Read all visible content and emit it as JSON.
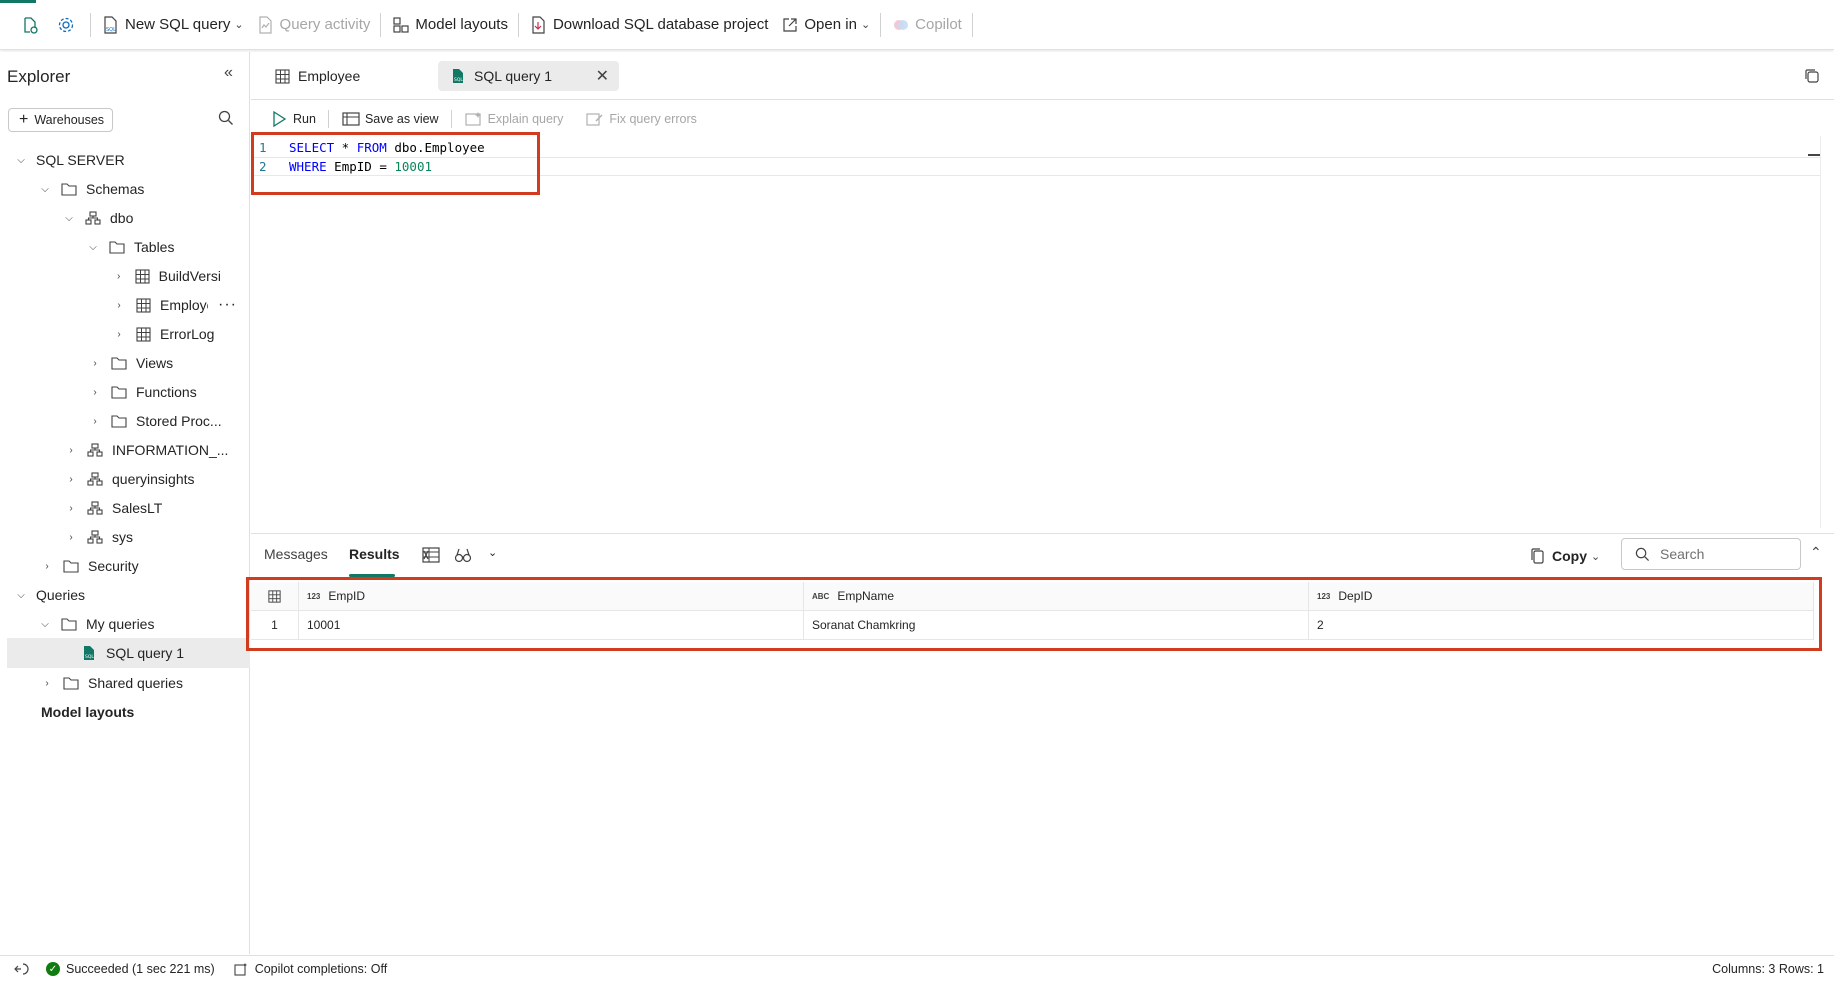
{
  "toolbar": {
    "new_sql_query": "New SQL query",
    "query_activity": "Query activity",
    "model_layouts": "Model layouts",
    "download_project": "Download SQL database project",
    "open_in": "Open in",
    "copilot": "Copilot"
  },
  "explorer": {
    "title": "Explorer",
    "add_button": "Warehouses",
    "tree": {
      "root": "SQL SERVER",
      "schemas": "Schemas",
      "dbo": "dbo",
      "tables": "Tables",
      "table_buildversion": "BuildVersic",
      "table_employee": "Employe",
      "table_errorlog": "ErrorLog",
      "views": "Views",
      "functions": "Functions",
      "stored_procs": "Stored Proc...",
      "information_schema": "INFORMATION_...",
      "queryinsights": "queryinsights",
      "saleslt": "SalesLT",
      "sys": "sys",
      "security": "Security",
      "queries": "Queries",
      "my_queries": "My queries",
      "sql_query_1": "SQL query 1",
      "shared_queries": "Shared queries",
      "model_layouts": "Model layouts"
    }
  },
  "tabs": [
    {
      "label": "Employee"
    },
    {
      "label": "SQL query 1"
    }
  ],
  "editor_toolbar": {
    "run": "Run",
    "save_as_view": "Save as view",
    "explain_query": "Explain query",
    "fix_errors": "Fix query errors"
  },
  "editor": {
    "lines": [
      {
        "num": "1",
        "kw1": "SELECT",
        "t1": " * ",
        "kw2": "FROM",
        "t2": " dbo.Employee"
      },
      {
        "num": "2",
        "kw1": "WHERE",
        "t1": " EmpID = ",
        "n1": "10001"
      }
    ]
  },
  "results": {
    "tab_messages": "Messages",
    "tab_results": "Results",
    "copy": "Copy",
    "search_placeholder": "Search",
    "columns": [
      {
        "type": "123",
        "name": "EmpID"
      },
      {
        "type": "ABC",
        "name": "EmpName"
      },
      {
        "type": "123",
        "name": "DepID"
      }
    ],
    "rows": [
      {
        "idx": "1",
        "EmpID": "10001",
        "EmpName": "Soranat Chamkring",
        "DepID": "2"
      }
    ]
  },
  "status": {
    "succeeded": "Succeeded (1 sec 221 ms)",
    "copilot_completions": "Copilot completions: Off",
    "summary": "Columns: 3 Rows: 1"
  },
  "colors": {
    "accent": "#117865",
    "highlight_box": "#d13c1f",
    "keyword": "#0000ff",
    "number": "#098658",
    "success": "#107c10"
  }
}
